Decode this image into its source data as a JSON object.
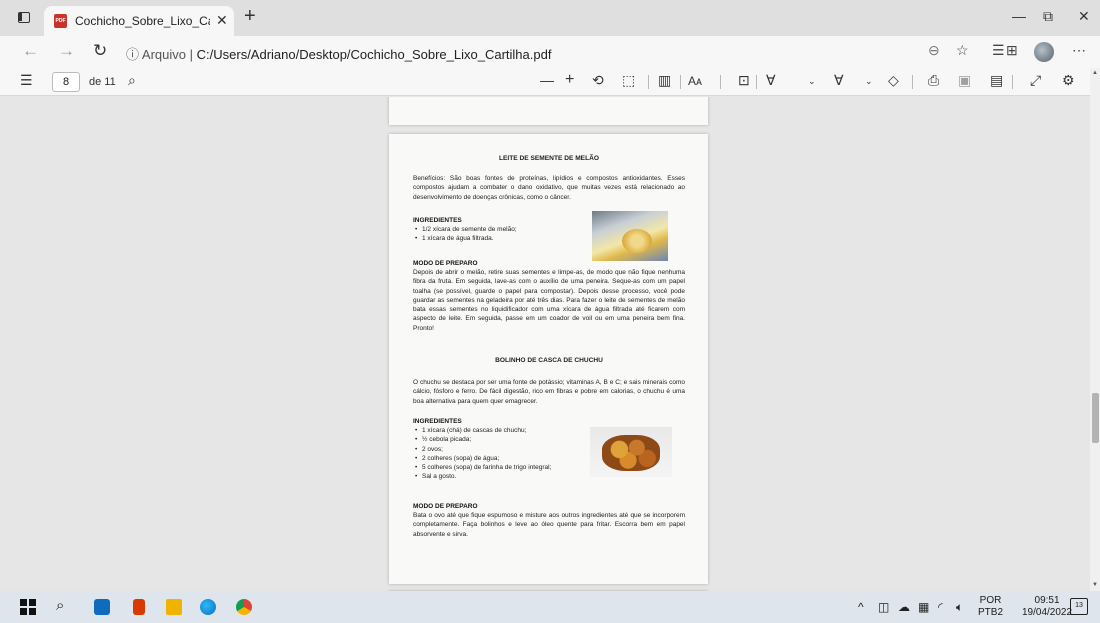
{
  "browser": {
    "tab_title": "Cochicho_Sobre_Lixo_Cartilha.pdf",
    "tab_close": "✕",
    "new_tab": "+",
    "win_minimize": "—",
    "win_restore": "⧉",
    "win_close": "✕",
    "address_prefix": "Arquivo",
    "address_separator": "|",
    "url": "C:/Users/Adriano/Desktop/Cochicho_Sobre_Lixo_Cartilha.pdf",
    "icons": [
      "back-icon",
      "forward-icon",
      "refresh-icon",
      "info-icon",
      "zoom-icon",
      "read-aloud-icon",
      "favorites-icon",
      "collections-icon",
      "profile-icon",
      "more-icon"
    ]
  },
  "pdf_toolbar": {
    "current_page": "8",
    "page_of": "de 11",
    "zoom_out": "—",
    "zoom_in": "+",
    "text_size": "Aᴀ"
  },
  "document": {
    "title1": "LEITE DE SEMENTE DE MELÃO",
    "benefits1": "Benefícios: São boas fontes de proteínas, lipídios e compostos antioxidantes. Esses compostos ajudam a combater o dano oxidativo, que muitas vezes está relacionado ao desenvolvimento de doenças crônicas, como o câncer.",
    "ingredients_label": "INGREDIENTES",
    "ingredients1": [
      "1/2 xícara de semente de melão;",
      "1 xícara de água filtrada."
    ],
    "method_label": "MODO DE PREPARO",
    "method1": "Depois de abrir o melão, retire suas sementes e limpe-as, de modo que não fique nenhuma fibra da fruta. Em seguida, lave-as com o auxílio de uma peneira. Seque-as com um papel toalha (se possível, guarde o papel para compostar). Depois desse processo, você pode guardar as sementes na geladeira por até três dias. Para fazer o leite de sementes de melão bata essas sementes no liquidificador com uma xícara de água filtrada até ficarem com aspecto de leite. Em seguida, passe em um coador de voil ou em uma peneira bem fina. Pronto!",
    "title2": "BOLINHO DE CASCA DE CHUCHU",
    "benefits2": "O chuchu se destaca por ser uma fonte de potássio; vitaminas A, B e C; e sais minerais como cálcio, fósforo e ferro. De fácil digestão, rico em fibras e pobre em calorias, o chuchu é uma boa alternativa para quem quer emagrecer.",
    "ingredients2": [
      "1 xícara (chá) de cascas de chuchu;",
      "½ cebola picada;",
      "2 ovos;",
      "2 colheres (sopa) de água;",
      "5 colheres (sopa) de farinha de trigo integral;",
      "Sal a gosto."
    ],
    "method2": "Bata o ovo até que fique espumoso e misture aos outros ingredientes até que se incorporem completamente. Faça bolinhos e leve ao óleo quente para fritar. Escorra bem em papel absorvente e sirva."
  },
  "taskbar": {
    "lang_line1": "POR",
    "lang_line2": "PTB2",
    "time": "09:51",
    "date": "19/04/2022",
    "notifications": "13"
  }
}
